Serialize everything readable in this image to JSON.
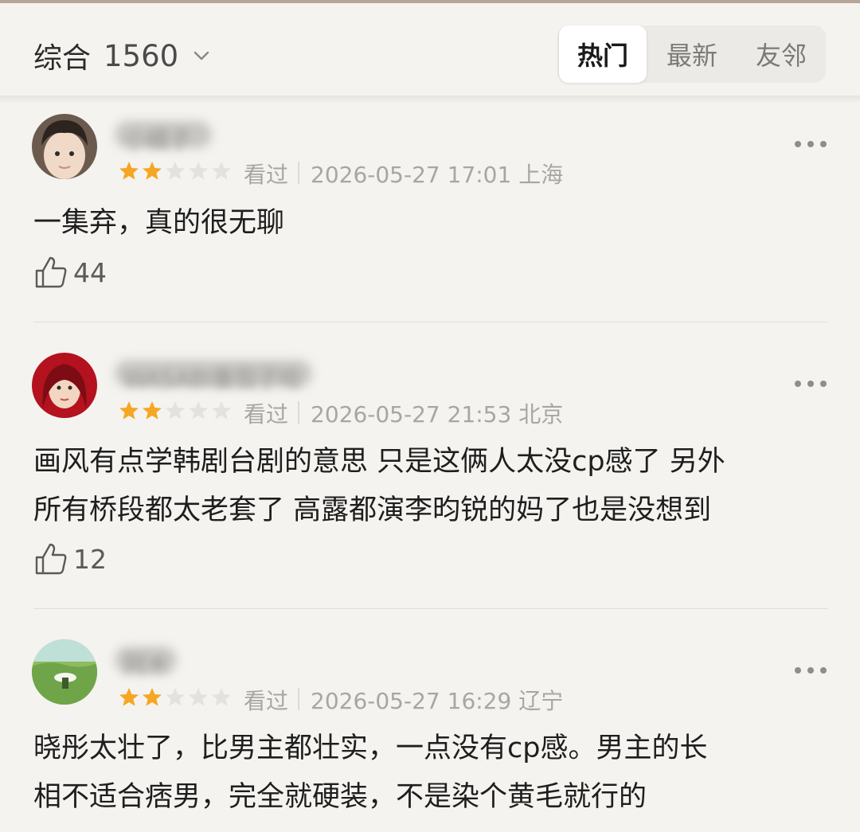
{
  "header": {
    "sort_label": "综合",
    "count": "1560",
    "tabs": [
      {
        "label": "热门",
        "active": true
      },
      {
        "label": "最新",
        "active": false
      },
      {
        "label": "友邻",
        "active": false
      }
    ]
  },
  "comments": [
    {
      "username": "小橘子",
      "rating": 2,
      "max_rating": 5,
      "status": "看过",
      "datetime": "2026-05-27 17:01",
      "location": "上海",
      "text": "一集弃，真的很无聊",
      "likes": "44"
    },
    {
      "username": "WASABI番茄子哈",
      "rating": 2,
      "max_rating": 5,
      "status": "看过",
      "datetime": "2026-05-27 21:53",
      "location": "北京",
      "text": "画风有点学韩剧台剧的意思 只是这俩人太没cp感了 另外\n所有桥段都太老套了 高露都演李昀锐的妈了也是没想到",
      "likes": "12"
    },
    {
      "username": "阿木",
      "rating": 2,
      "max_rating": 5,
      "status": "看过",
      "datetime": "2026-05-27 16:29",
      "location": "辽宁",
      "text": "晓彤太壮了，比男主都壮实，一点没有cp感。男主的长\n相不适合痞男，完全就硬装，不是染个黄毛就行的",
      "likes": ""
    }
  ],
  "colors": {
    "background": "#f4f3ef",
    "star_filled": "#f5a623",
    "star_empty": "#e4e2de",
    "meta_text": "#a8a6a2"
  }
}
